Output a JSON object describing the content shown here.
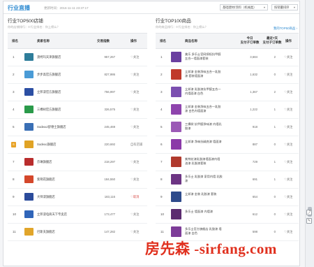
{
  "header": {
    "title": "行业直播",
    "update": "更新时间：2016-11-11 23:37:17",
    "select_category": "基础建材/涂料（机械类）",
    "select_sort": "按销量排序"
  },
  "shops": {
    "title": "行业TOP500店铺",
    "subtitle": "你的店铺排行：0  行业排名：你上榜么？",
    "headers": {
      "rank": "排名",
      "name": "卖家名称",
      "sales": "交易指数",
      "action": "操作"
    },
    "rows": [
      {
        "rank": "1",
        "name": "澳柯玛天津旗舰店",
        "sales": "957,267",
        "action": "♡关注",
        "color": "#2e7d9a",
        "red": false
      },
      {
        "rank": "2",
        "name": "步步高官方旗舰店",
        "sales": "827,986",
        "action": "♡关注",
        "color": "#4a9bd6",
        "red": false
      },
      {
        "rank": "3",
        "name": "立邦漆官方旗舰店",
        "sales": "756,997",
        "action": "♡关注",
        "color": "#2c4fa3",
        "red": false
      },
      {
        "rank": "4",
        "name": "三棵树官方旗舰店",
        "sales": "326,575",
        "action": "♡关注",
        "color": "#2a9a4a",
        "red": false
      },
      {
        "rank": "5",
        "name": "Sodexo/舒德士旗舰店",
        "sales": "245,469",
        "action": "♡关注",
        "color": "#3a6fb5",
        "red": false
      },
      {
        "rank": "6",
        "name": "Sodexo旗舰店",
        "sales": "220,692",
        "action": "自有店铺",
        "color": "#e0a325",
        "red": false,
        "badge": true
      },
      {
        "rank": "7",
        "name": "芬琳旗舰店",
        "sales": "218,297",
        "action": "♡关注",
        "color": "#b92d2d",
        "red": false
      },
      {
        "rank": "8",
        "name": "紫荆花旗舰店",
        "sales": "184,550",
        "action": "♡关注",
        "color": "#d4472b",
        "red": false
      },
      {
        "rank": "9",
        "name": "大师漆旗舰店",
        "sales": "183,116",
        "action": "♡取消",
        "color": "#2b4b9b",
        "red": true
      },
      {
        "rank": "10",
        "name": "立邦漆电商天下专卖店",
        "sales": "173,477",
        "action": "♡关注",
        "color": "#3065b9",
        "red": false
      },
      {
        "rank": "11",
        "name": "巴斯夫旗舰店",
        "sales": "147,282",
        "action": "♡关注",
        "color": "#e1a52a",
        "red": false
      }
    ]
  },
  "products": {
    "title": "行业TOP100商品",
    "subtitle": "你的商品排行：0  行业排名：你上榜么？",
    "link": "我的TOP50商品 ›",
    "headers": {
      "rank": "排名",
      "name": "商品名称",
      "today": "今日\n支付子订单数",
      "week": "最近7天\n支付子订单数",
      "action": "操作"
    },
    "rows": [
      {
        "rank": "1",
        "name": "美乐 多乐士官网授权抗甲醛五合一墙面漆套装",
        "today": "3,684",
        "week": "2",
        "action": "♡关注",
        "color": "#6a3fa0"
      },
      {
        "rank": "2",
        "name": "立邦漆 金装净味五合一乳胶漆 套装墙面漆",
        "today": "1,632",
        "week": "0",
        "action": "♡关注",
        "color": "#c0392b"
      },
      {
        "rank": "3",
        "name": "立邦漆 乳胶漆抗甲醛五合一内墙面漆 白色",
        "today": "1,367",
        "week": "2",
        "action": "♡关注",
        "color": "#7b4fb0"
      },
      {
        "rank": "4",
        "name": "立邦漆 金装净味五合一乳胶漆 白色内墙面漆",
        "today": "1,222",
        "week": "1",
        "action": "♡关注",
        "color": "#8e44ad"
      },
      {
        "rank": "5",
        "name": "三棵树 抗甲醛净味漆 内墙乳胶漆",
        "today": "918",
        "week": "1",
        "action": "♡关注",
        "color": "#9b59b6"
      },
      {
        "rank": "6",
        "name": "立邦漆 净味抗碱底漆 墙面漆",
        "today": "887",
        "week": "0",
        "action": "♡关注",
        "color": "#8b3aa8"
      },
      {
        "rank": "7",
        "name": "紫荆花漆乳胶漆墙面漆内墙油漆 乳胶漆套装",
        "today": "729",
        "week": "1",
        "action": "♡关注",
        "color": "#b03a2e"
      },
      {
        "rank": "8",
        "name": "多乐士 乳胶漆 家用内墙 乳胶漆",
        "today": "691",
        "week": "1",
        "action": "♡关注",
        "color": "#6c3483"
      },
      {
        "rank": "9",
        "name": "立邦漆 金装 乳胶漆 套装",
        "today": "654",
        "week": "0",
        "action": "♡关注",
        "color": "#2e4a8b"
      },
      {
        "rank": "10",
        "name": "多乐士 墙面漆 内墙漆",
        "today": "612",
        "week": "0",
        "action": "♡关注",
        "color": "#5b2c6f"
      },
      {
        "rank": "11",
        "name": "多乐士官方旗舰店 乳胶漆 墙面漆 白色",
        "today": "598",
        "week": "0",
        "action": "♡关注",
        "color": "#7d3c98"
      }
    ]
  },
  "watermark": {
    "text": "房先森 -sirfang.com"
  }
}
